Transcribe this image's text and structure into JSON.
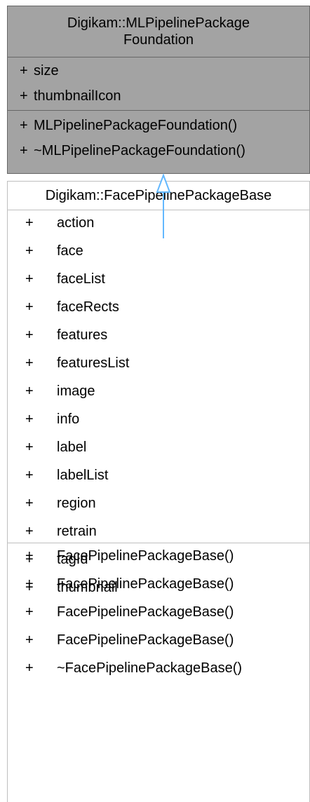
{
  "base_class": {
    "title_line1": "Digikam::MLPipelinePackage",
    "title_line2": "Foundation",
    "attributes": [
      "size",
      "thumbnailIcon"
    ],
    "operations": [
      "MLPipelinePackageFoundation()",
      "~MLPipelinePackageFoundation()"
    ],
    "visibility": "+"
  },
  "derived_class": {
    "title": "Digikam::FacePipelinePackageBase",
    "attributes": [
      "action",
      "face",
      "faceList",
      "faceRects",
      "features",
      "featuresList",
      "image",
      "info",
      "label",
      "labelList",
      "region",
      "retrain",
      "tagId",
      "thumbnail"
    ],
    "operations": [
      "FacePipelinePackageBase()",
      "FacePipelinePackageBase()",
      "FacePipelinePackageBase()",
      "FacePipelinePackageBase()",
      "~FacePipelinePackageBase()"
    ],
    "visibility": "+"
  },
  "colors": {
    "base_fill": "#a3a3a3",
    "arrow": "#63b8ff",
    "border": "#666666"
  }
}
